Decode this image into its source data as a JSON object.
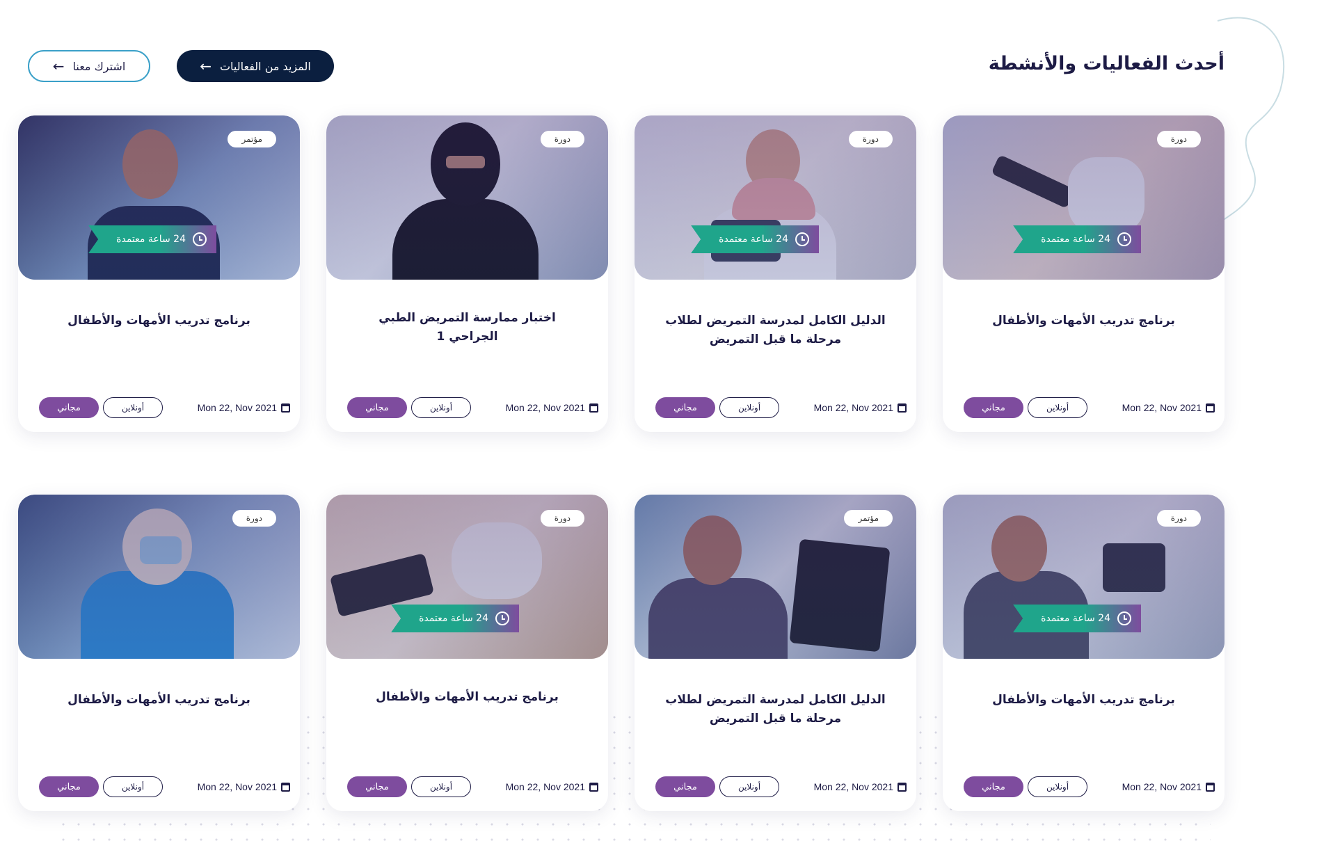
{
  "header": {
    "title": "أحدث الفعاليات والأنشطة",
    "more_events_label": "المزيد من الفعاليات",
    "subscribe_label": "اشترك معنا"
  },
  "colors": {
    "primary_dark": "#0b1f3f",
    "accent_purple": "#7e4c9e",
    "accent_green": "#1fa58b",
    "outline_blue": "#3aa0c8",
    "text": "#1d1b45"
  },
  "icons": {
    "arrow": "arrow-left-icon",
    "clock": "clock-icon",
    "calendar": "calendar-icon"
  },
  "cards": [
    {
      "type": "دورة",
      "hours": "24 ساعة معتمدة",
      "title": "برنامج تدريب الأمهات والأطفال",
      "date": "Mon 22, Nov 2021",
      "mode": "أونلاين",
      "price": "مجاني"
    },
    {
      "type": "دورة",
      "hours": "24 ساعة معتمدة",
      "title": "الدليل الكامل لمدرسة التمريض لطلاب مرحلة ما قبل التمريض",
      "date": "Mon 22, Nov 2021",
      "mode": "أونلاين",
      "price": "مجاني"
    },
    {
      "type": "دورة",
      "hours": "",
      "title": "اختبار ممارسة التمريض الطبي الجراحي 1",
      "date": "Mon 22, Nov 2021",
      "mode": "أونلاين",
      "price": "مجاني"
    },
    {
      "type": "مؤتمر",
      "hours": "24 ساعة معتمدة",
      "title": "برنامج تدريب الأمهات والأطفال",
      "date": "Mon 22, Nov 2021",
      "mode": "أونلاين",
      "price": "مجاني"
    },
    {
      "type": "دورة",
      "hours": "24 ساعة معتمدة",
      "title": "برنامج تدريب الأمهات والأطفال",
      "date": "Mon 22, Nov 2021",
      "mode": "أونلاين",
      "price": "مجاني"
    },
    {
      "type": "مؤتمر",
      "hours": "",
      "title": "الدليل الكامل لمدرسة التمريض لطلاب مرحلة ما قبل التمريض",
      "date": "Mon 22, Nov 2021",
      "mode": "أونلاين",
      "price": "مجاني"
    },
    {
      "type": "دورة",
      "hours": "24 ساعة معتمدة",
      "title": "برنامج تدريب الأمهات والأطفال",
      "date": "Mon 22, Nov 2021",
      "mode": "أونلاين",
      "price": "مجاني"
    },
    {
      "type": "دورة",
      "hours": "",
      "title": "برنامج تدريب الأمهات والأطفال",
      "date": "Mon 22, Nov 2021",
      "mode": "أونلاين",
      "price": "مجاني"
    }
  ]
}
